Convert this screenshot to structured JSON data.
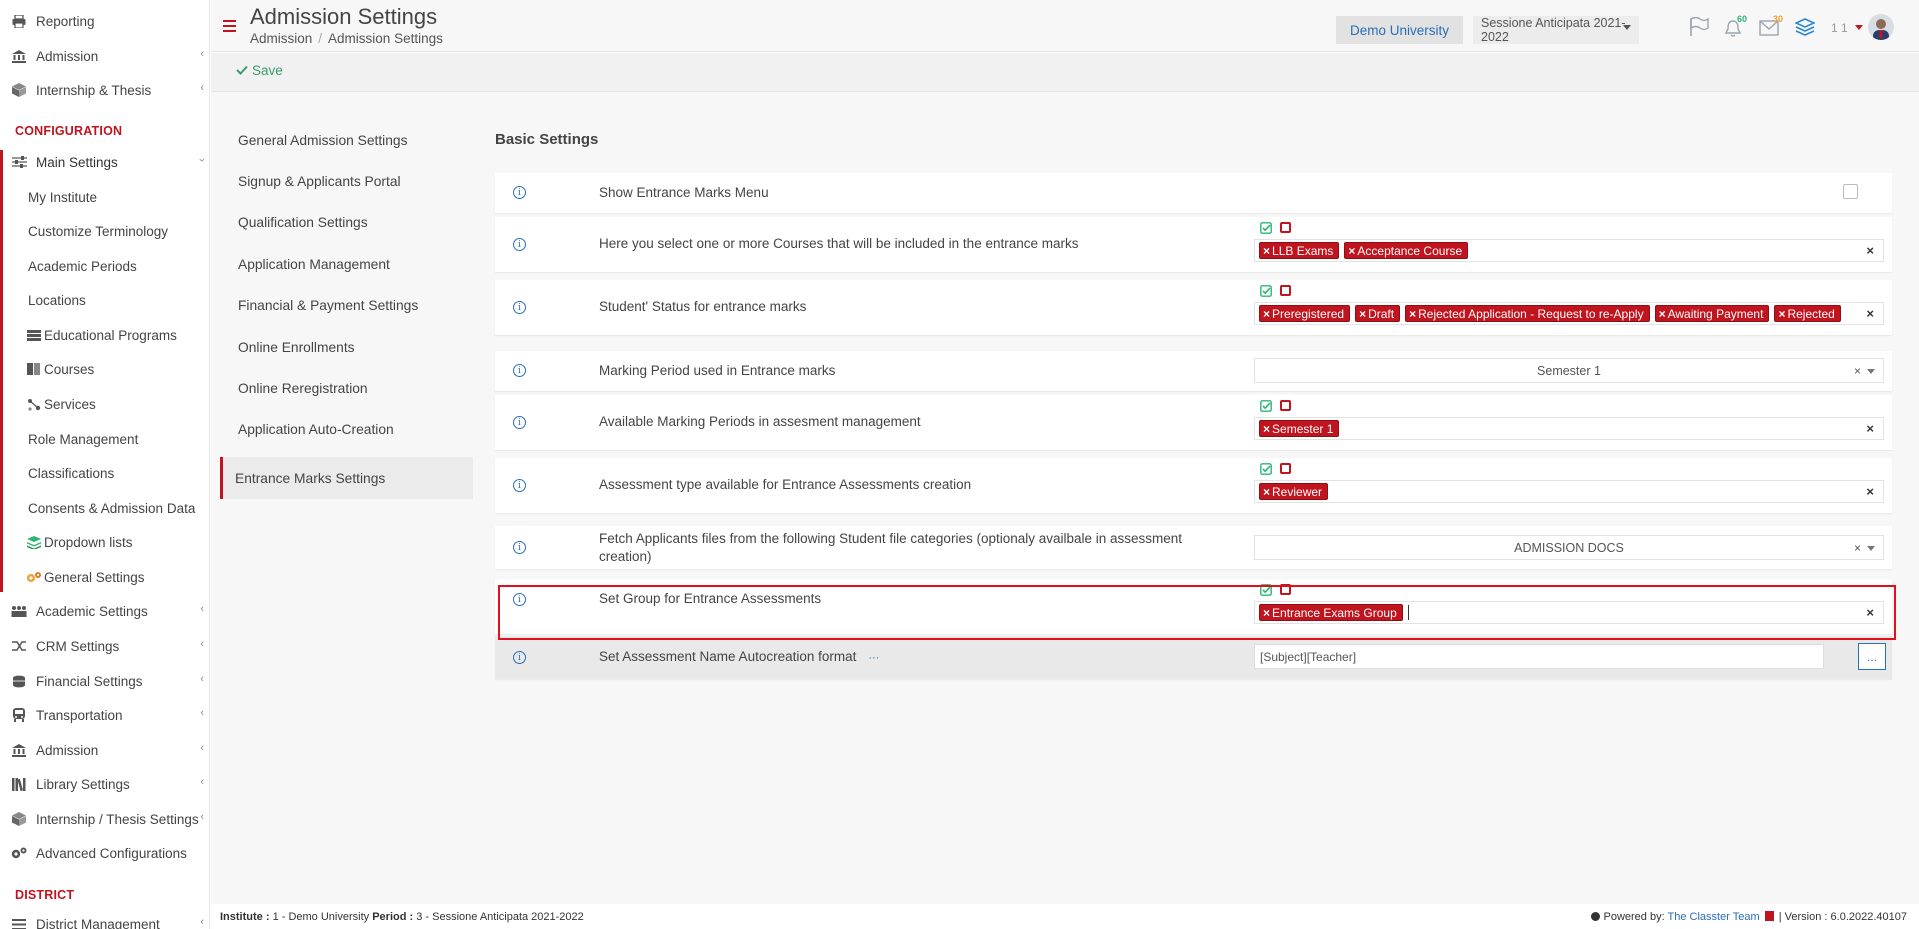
{
  "sidebar": {
    "top_items": [
      {
        "label": "Reporting",
        "icon": "printer-icon"
      },
      {
        "label": "Admission",
        "icon": "bank-icon"
      },
      {
        "label": "Internship & Thesis",
        "icon": "box-icon"
      }
    ],
    "config_heading": "CONFIGURATION",
    "main_settings": "Main Settings",
    "sub_items": [
      "My Institute",
      "Customize Terminology",
      "Academic Periods",
      "Locations",
      "Educational Programs",
      "Courses",
      "Services",
      "Role Management",
      "Classifications",
      "Consents & Admission Data",
      "Dropdown lists",
      "General Settings"
    ],
    "settings_items": [
      "Academic Settings",
      "CRM Settings",
      "Financial Settings",
      "Transportation",
      "Admission",
      "Library Settings",
      "Internship / Thesis Settings",
      "Advanced Configurations"
    ],
    "district_heading": "DISTRICT",
    "district_item": "District Management"
  },
  "header": {
    "title": "Admission Settings",
    "breadcrumb": [
      "Admission",
      "Admission Settings"
    ],
    "institution": "Demo University",
    "session": "Sessione Anticipata 2021-2022",
    "notif_count": "60",
    "mail_count": "30",
    "user_label": "1 1"
  },
  "toolbar": {
    "save_label": "Save"
  },
  "settings_nav": [
    "General Admission Settings",
    "Signup & Applicants Portal",
    "Qualification Settings",
    "Application Management",
    "Financial & Payment Settings",
    "Online Enrollments",
    "Online Reregistration",
    "Application Auto-Creation",
    "Entrance Marks Settings"
  ],
  "panel": {
    "title": "Basic Settings",
    "rows": [
      {
        "label": "Show Entrance Marks Menu"
      },
      {
        "label": "Here you select one or more Courses that will be included in the entrance marks",
        "tags": [
          "LLB Exams",
          "Acceptance Course"
        ]
      },
      {
        "label": "Student' Status for entrance marks",
        "tags": [
          "Preregistered",
          "Draft",
          "Rejected Application - Request to re-Apply",
          "Awaiting Payment",
          "Rejected"
        ]
      },
      {
        "label": "Marking Period used in Entrance marks",
        "select": "Semester 1"
      },
      {
        "label": "Available Marking Periods in assesment management",
        "tags": [
          "Semester 1"
        ]
      },
      {
        "label": "Assessment type available for Entrance Assessments creation",
        "tags": [
          "Reviewer"
        ]
      },
      {
        "label": "Fetch Applicants files from the following Student file categories (optionaly availbale in assessment creation)",
        "select": "ADMISSION DOCS"
      },
      {
        "label": "Set Group for Entrance Assessments",
        "tags": [
          "Entrance Exams Group"
        ]
      },
      {
        "label": "Set Assessment Name Autocreation format",
        "dots": "···",
        "value": "[Subject][Teacher]",
        "button": "..."
      }
    ]
  },
  "footer": {
    "institute_label": "Institute :",
    "institute_value": "1 - Demo University",
    "period_label": "Period :",
    "period_value": "3 - Sessione Anticipata 2021-2022",
    "powered_by": "Powered by:",
    "team": "The Classter Team",
    "version": "| Version : 6.0.2022.40107"
  },
  "colors": {
    "accent": "#c0141e",
    "link": "#2a6fb5",
    "success": "#3a9b6a"
  }
}
